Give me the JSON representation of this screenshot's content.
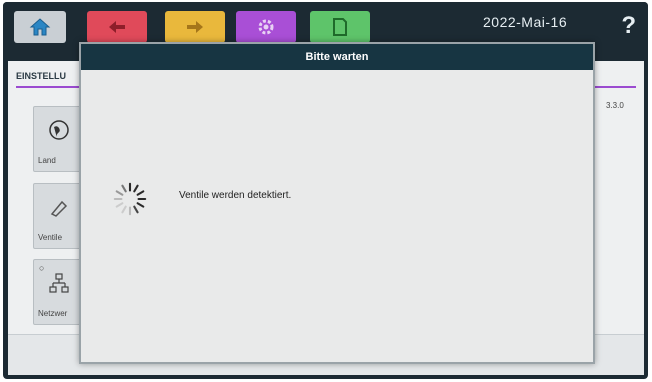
{
  "topbar": {
    "date": "2022-Mai-16",
    "help_label": "?",
    "buttons": [
      {
        "name": "home",
        "icon": "home-icon",
        "color": "#c9cfd4"
      },
      {
        "name": "back",
        "icon": "back-arrow-icon",
        "color": "#e04a5a"
      },
      {
        "name": "forward",
        "icon": "forward-arrow-icon",
        "color": "#e9b83c"
      },
      {
        "name": "settings",
        "icon": "gear-icon",
        "color": "#a94fd6"
      },
      {
        "name": "document",
        "icon": "document-icon",
        "color": "#5ec46a"
      }
    ]
  },
  "settings_page": {
    "title": "EINSTELLU",
    "version": "3.3.0",
    "tiles": [
      {
        "label": "Land",
        "icon": "globe-icon"
      },
      {
        "label": "Ventile",
        "icon": "valve-icon"
      },
      {
        "label": "Netzwer",
        "icon": "network-icon",
        "locked": true
      }
    ]
  },
  "dialog": {
    "title": "Bitte warten",
    "message": "Ventile werden detektiert.",
    "icon": "spinner-icon"
  },
  "colors": {
    "header": "#173542",
    "accent": "#9b4bd0",
    "frame": "#1c2a33"
  }
}
